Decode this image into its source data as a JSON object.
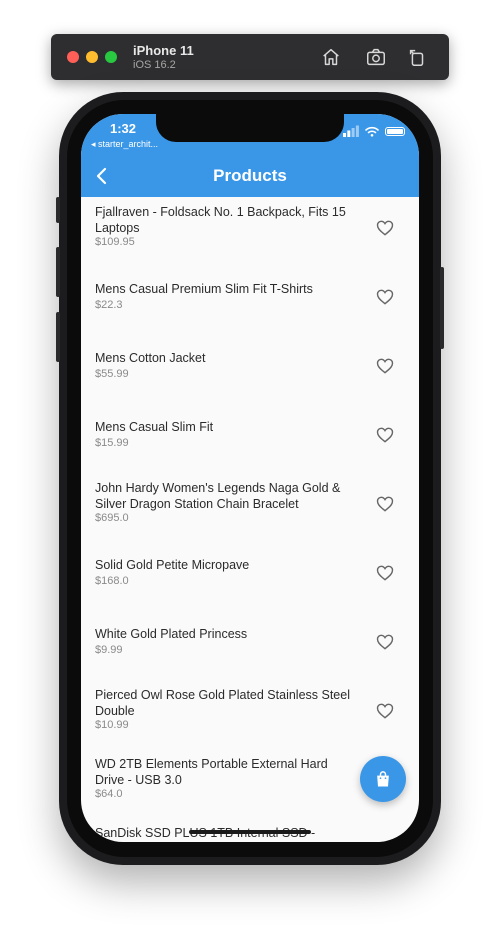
{
  "simulator": {
    "device": "iPhone 11",
    "os": "iOS 16.2"
  },
  "status_bar": {
    "time": "1:32",
    "back_app": "◂ starter_archit..."
  },
  "app_bar": {
    "title": "Products"
  },
  "products": [
    {
      "name": "Fjallraven - Foldsack No. 1 Backpack, Fits 15 Laptops",
      "price": "$109.95"
    },
    {
      "name": "Mens Casual Premium Slim Fit T-Shirts",
      "price": "$22.3"
    },
    {
      "name": "Mens Cotton Jacket",
      "price": "$55.99"
    },
    {
      "name": "Mens Casual Slim Fit",
      "price": "$15.99"
    },
    {
      "name": "John Hardy Women's Legends Naga Gold & Silver Dragon Station Chain Bracelet",
      "price": "$695.0"
    },
    {
      "name": "Solid Gold Petite Micropave",
      "price": "$168.0"
    },
    {
      "name": "White Gold Plated Princess",
      "price": "$9.99"
    },
    {
      "name": "Pierced Owl Rose Gold Plated Stainless Steel Double",
      "price": "$10.99"
    },
    {
      "name": "WD 2TB Elements Portable External Hard Drive - USB 3.0",
      "price": "$64.0"
    },
    {
      "name": "SanDisk SSD PLUS 1TB Internal SSD -",
      "price": ""
    }
  ],
  "colors": {
    "accent": "#3a97e8",
    "background": "#fafafa"
  },
  "icons": {
    "favorite": "heart-outline-icon",
    "cart": "shopping-bag-icon",
    "back": "chevron-left-icon"
  }
}
